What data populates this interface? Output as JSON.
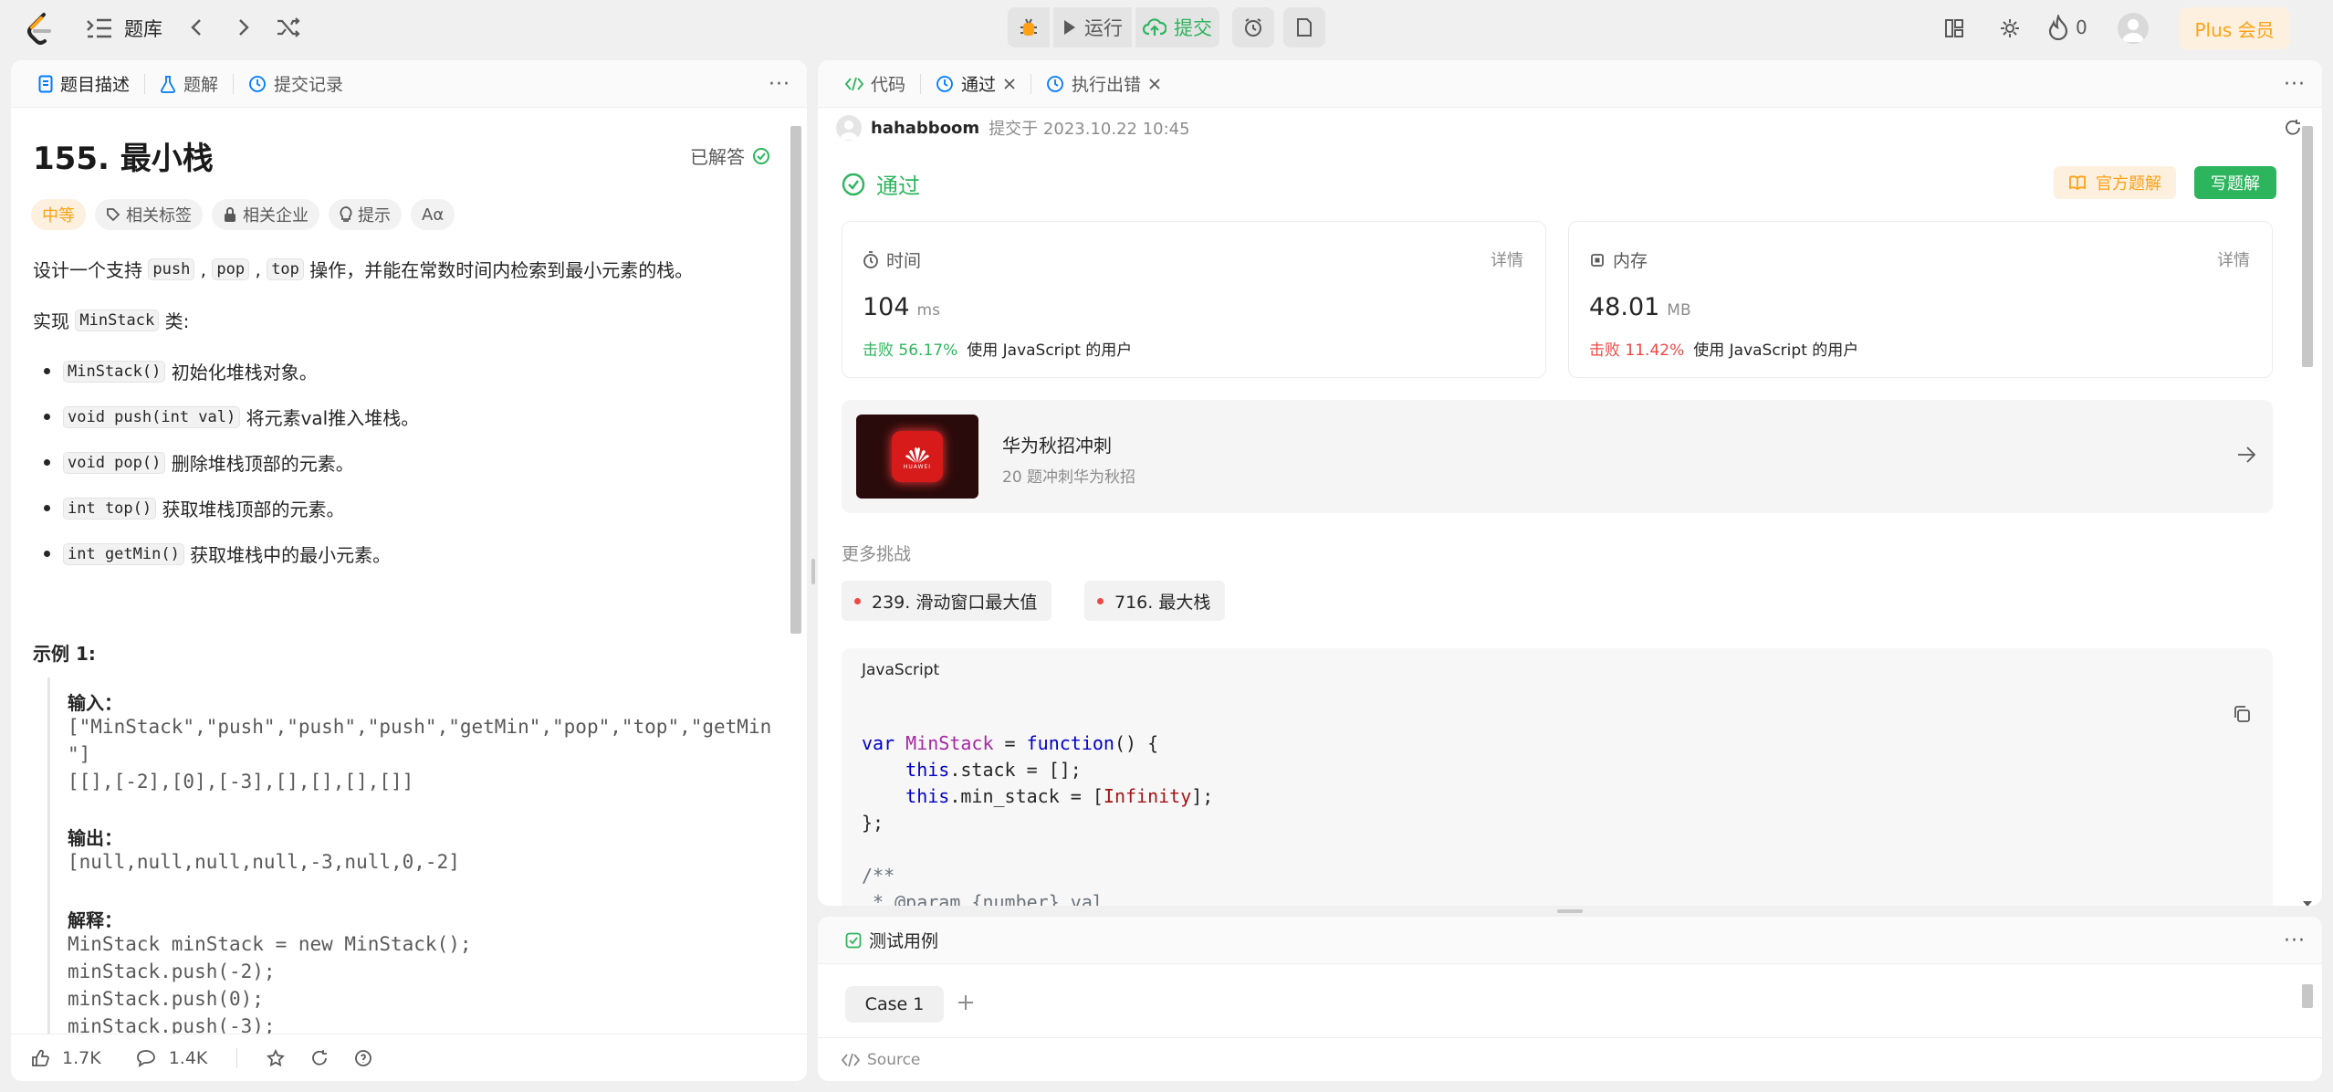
{
  "topbar": {
    "problem_list": "题库",
    "run": "运行",
    "submit": "提交",
    "streak": "0",
    "plus": "Plus 会员"
  },
  "left": {
    "tabs": [
      "题目描述",
      "题解",
      "提交记录"
    ],
    "title": "155. 最小栈",
    "solved": "已解答",
    "tags": {
      "difficulty": "中等",
      "related_tags": "相关标签",
      "companies": "相关企业",
      "hints": "提示",
      "font": "Aα"
    },
    "desc1_pre": "设计一个支持 ",
    "desc1_c1": "push",
    "desc1_c2": "pop",
    "desc1_c3": "top",
    "desc1_post": " 操作，并能在常数时间内检索到最小元素的栈。",
    "desc2_pre": "实现 ",
    "desc2_code": "MinStack",
    "desc2_post": " 类:",
    "bullets": [
      {
        "code": "MinStack()",
        "text": " 初始化堆栈对象。"
      },
      {
        "code": "void push(int val)",
        "text": " 将元素val推入堆栈。"
      },
      {
        "code": "void pop()",
        "text": " 删除堆栈顶部的元素。"
      },
      {
        "code": "int top()",
        "text": " 获取堆栈顶部的元素。"
      },
      {
        "code": "int getMin()",
        "text": " 获取堆栈中的最小元素。"
      }
    ],
    "example_title": "示例 1:",
    "input_label": "输入：",
    "input_lines": [
      "[\"MinStack\",\"push\",\"push\",\"push\",\"getMin\",\"pop\",\"top\",\"getMin",
      "\"]",
      "[[],[-2],[0],[-3],[],[],[],[]]"
    ],
    "output_label": "输出：",
    "output_line": "[null,null,null,null,-3,null,0,-2]",
    "explain_label": "解释：",
    "explain_lines": [
      "MinStack minStack = new MinStack();",
      "minStack.push(-2);",
      "minStack.push(0);",
      "minStack.push(-3);"
    ],
    "footer": {
      "likes": "1.7K",
      "comments": "1.4K"
    }
  },
  "right": {
    "tabs": [
      "代码",
      "通过",
      "执行出错"
    ],
    "user": "hahabboom",
    "submitted_at": "提交于 2023.10.22 10:45",
    "status": "通过",
    "official_solution": "官方题解",
    "write_solution": "写题解",
    "time": {
      "label": "时间",
      "detail": "详情",
      "value": "104",
      "unit": "ms",
      "beat_label": "击败",
      "beat": "56.17%",
      "beat_suffix": "使用 JavaScript 的用户"
    },
    "memory": {
      "label": "内存",
      "detail": "详情",
      "value": "48.01",
      "unit": "MB",
      "beat_label": "击败",
      "beat": "11.42%",
      "beat_suffix": "使用 JavaScript 的用户"
    },
    "promo": {
      "title": "华为秋招冲刺",
      "subtitle": "20 题冲刺华为秋招",
      "logo_text": "HUAWEI"
    },
    "more_challenges": "更多挑战",
    "challenges": [
      "239. 滑动窗口最大值",
      "716. 最大栈"
    ],
    "lang": "JavaScript",
    "testcase_tab": "测试用例",
    "case1": "Case 1",
    "source": "Source"
  },
  "colors": {
    "green": "#2db55d",
    "orange": "#ffa116",
    "red": "#ef4743",
    "plus_bg": "#fdf0de"
  }
}
